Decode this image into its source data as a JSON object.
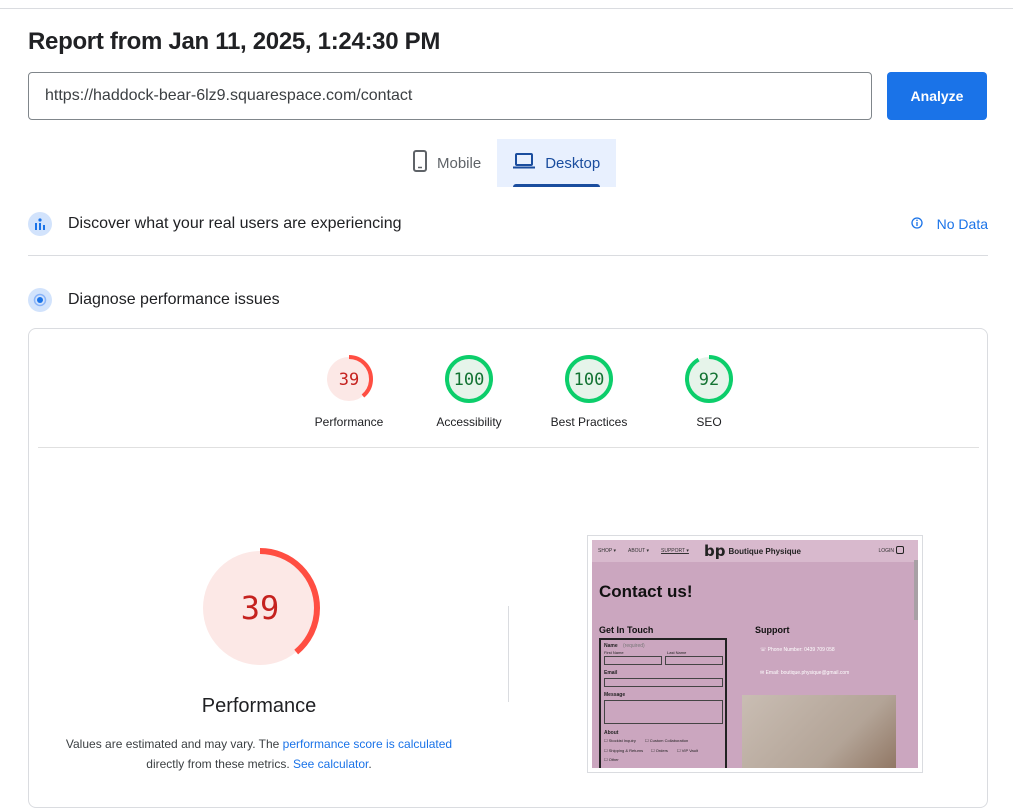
{
  "report": {
    "title": "Report from Jan 11, 2025, 1:24:30 PM",
    "url": "https://haddock-bear-6lz9.squarespace.com/contact",
    "analyze_label": "Analyze"
  },
  "tabs": [
    {
      "label": "Mobile",
      "icon": "smartphone-icon",
      "active": false
    },
    {
      "label": "Desktop",
      "icon": "laptop-icon",
      "active": true
    }
  ],
  "sections": {
    "real_users": {
      "title": "Discover what your real users are experiencing",
      "status": "No Data"
    },
    "diagnose": {
      "title": "Diagnose performance issues"
    }
  },
  "scores": [
    {
      "label": "Performance",
      "value": "39",
      "color": "#ff4e42",
      "bg": "#fce8e6",
      "text": "#c5221f",
      "fraction": 0.39
    },
    {
      "label": "Accessibility",
      "value": "100",
      "color": "#0cce6b",
      "bg": "#e6f4ea",
      "text": "#137333",
      "fraction": 1.0
    },
    {
      "label": "Best Practices",
      "value": "100",
      "color": "#0cce6b",
      "bg": "#e6f4ea",
      "text": "#137333",
      "fraction": 1.0
    },
    {
      "label": "SEO",
      "value": "92",
      "color": "#0cce6b",
      "bg": "#e6f4ea",
      "text": "#137333",
      "fraction": 0.92
    }
  ],
  "performance": {
    "score": "39",
    "label": "Performance",
    "note_prefix": "Values are estimated and may vary. The ",
    "note_link1": "performance score is calculated",
    "note_middle": "directly from these metrics. ",
    "note_link2": "See calculator",
    "note_suffix": "."
  },
  "screenshot": {
    "nav": [
      "SHOP ▾",
      "ABOUT ▾",
      "SUPPORT ▾"
    ],
    "brand_mark": "bp",
    "brand": "Boutique Physique",
    "login": "LOGIN",
    "heading": "Contact us!",
    "get_in_touch": "Get In Touch",
    "support": "Support",
    "name_label": "Name",
    "required": "(required)",
    "first_name": "First Name",
    "last_name": "Last Name",
    "email_label": "Email",
    "message_label": "Message",
    "about_label": "About",
    "options": [
      "Stockist Inquiry",
      "Custom Collaboration",
      "Shipping & Returns",
      "Orders",
      "VIP Vault",
      "Other"
    ],
    "phone": "Phone Number: 0439 709 058",
    "email": "Email: boutique.physique@gmail.com"
  },
  "colors": {
    "accent": "#1a73e8",
    "fail": "#ff4e42",
    "pass": "#0cce6b"
  }
}
